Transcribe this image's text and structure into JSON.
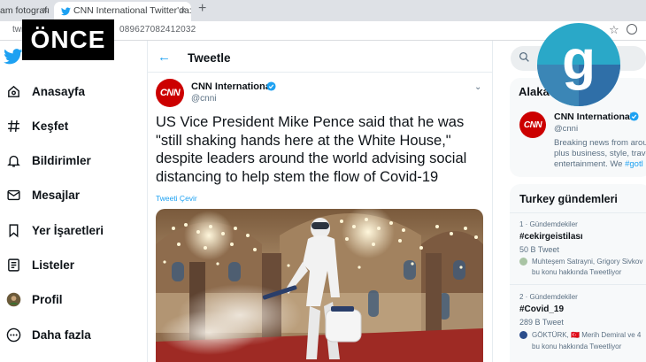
{
  "browser": {
    "tabs": [
      {
        "label": "am fotografı",
        "close": "×"
      },
      {
        "label": "CNN International Twitter'da: \"US",
        "close": "×"
      }
    ],
    "new_tab": "+",
    "url_start": "twi",
    "url_rest": "089627082412032"
  },
  "overlay": {
    "label": "ÖNCE",
    "logo_letter": "g"
  },
  "nav": {
    "items": [
      {
        "label": "Anasayfa",
        "icon": "home-icon"
      },
      {
        "label": "Keşfet",
        "icon": "hashtag-icon"
      },
      {
        "label": "Bildirimler",
        "icon": "bell-icon"
      },
      {
        "label": "Mesajlar",
        "icon": "mail-icon"
      },
      {
        "label": "Yer İşaretleri",
        "icon": "bookmark-icon"
      },
      {
        "label": "Listeler",
        "icon": "list-icon"
      },
      {
        "label": "Profil",
        "icon": "avatar"
      },
      {
        "label": "Daha fazla",
        "icon": "more-icon"
      }
    ]
  },
  "header": {
    "back": "←",
    "title": "Tweetle"
  },
  "tweet": {
    "avatar_text": "CNN",
    "author": "CNN International",
    "handle": "@cnni",
    "text": "US Vice President Mike Pence said that he was \"still shaking hands here at the White House,\" despite leaders around the world advising social distancing to help stem the flow of Covid-19",
    "translate": "Tweeti Çevir"
  },
  "right": {
    "panel_title": "Alaka",
    "suggestion": {
      "avatar_text": "CNN",
      "name": "CNN International",
      "handle": "@cnni",
      "bio_1": "Breaking news from arou",
      "bio_2": "plus business, style, trave",
      "bio_3": "entertainment. We ",
      "bio_link": "#gotl"
    },
    "trends_title": "Turkey gündemleri",
    "trends": [
      {
        "meta": "1 · Gündemdekiler",
        "tag": "#cekirgeistilası",
        "count": "50 B Tweet",
        "people": "Muhteşem Satrayni, Grigory Sivkov",
        "sub": "bu konu hakkında Tweetliyor"
      },
      {
        "meta": "2 · Gündemdekiler",
        "tag": "#Covid_19",
        "count": "289 B Tweet",
        "people": "GÖKTÜRK, 🇹🇷 Merih Demiral ve 4",
        "sub": "bu konu hakkında Tweetliyor"
      }
    ]
  },
  "colors": {
    "twitter_blue": "#1da1f2",
    "cnn_red": "#cc0000"
  }
}
